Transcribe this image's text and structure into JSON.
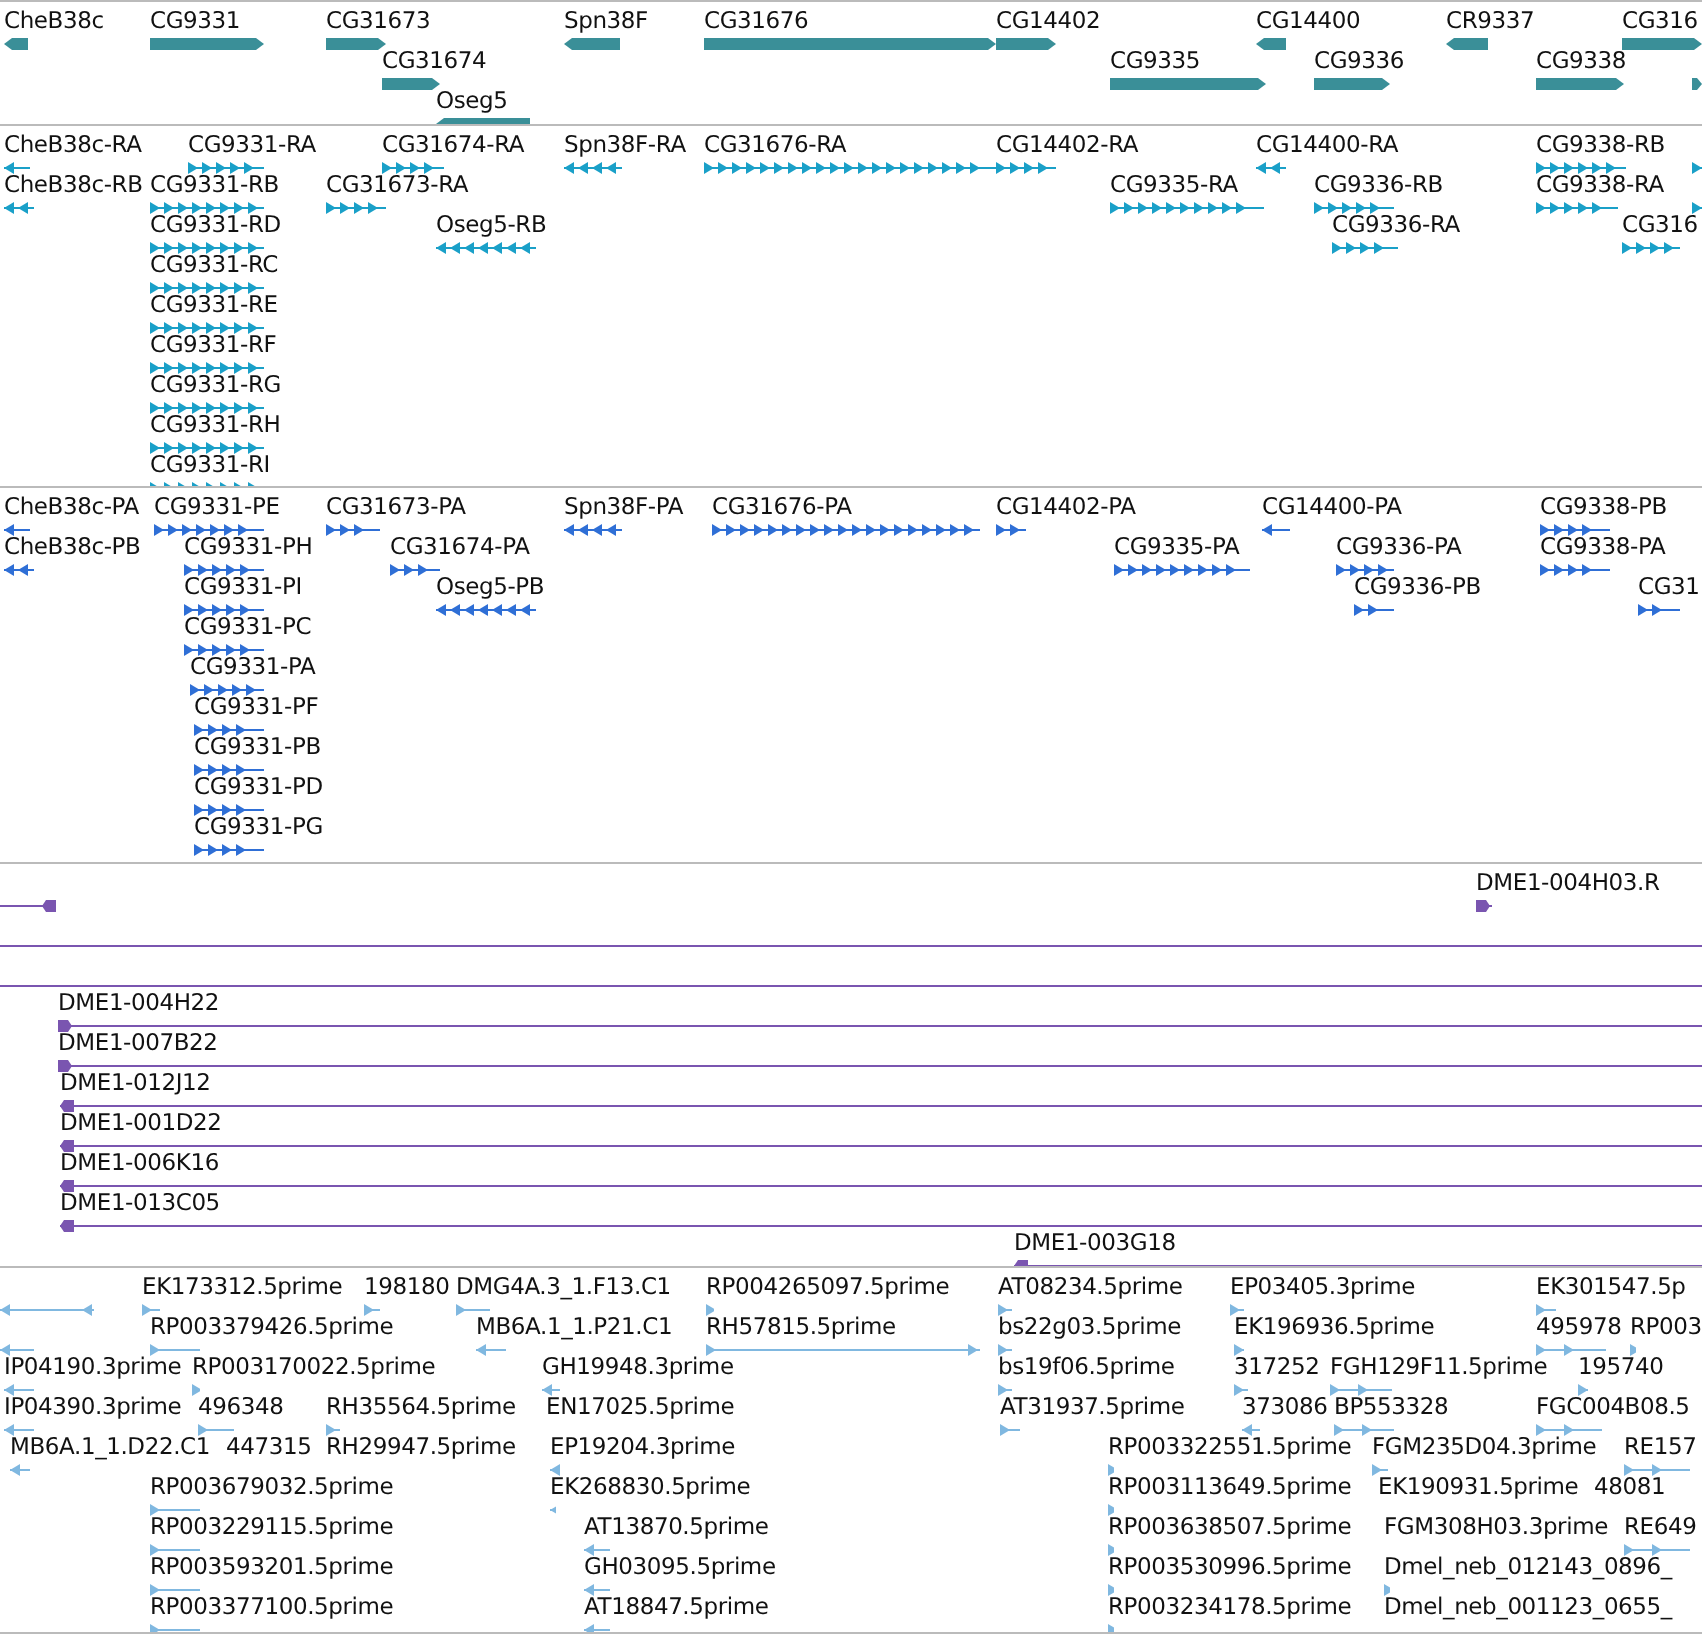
{
  "tracks": [
    {
      "kind": "gene",
      "color": "#3a8f98",
      "features": [
        {
          "label": "CheB38c",
          "reverse": true
        },
        {
          "label": "CG9331",
          "reverse": false
        },
        {
          "label": "CG31673",
          "reverse": false
        },
        {
          "label": "Spn38F",
          "reverse": true
        },
        {
          "label": "CG31676",
          "reverse": false
        },
        {
          "label": "CG14402",
          "reverse": false
        },
        {
          "label": "CG14400",
          "reverse": true
        },
        {
          "label": "CR9337",
          "reverse": true
        },
        {
          "label": "CG316",
          "reverse": false
        },
        {
          "label": "CG31674",
          "reverse": false
        },
        {
          "label": "CG9335",
          "reverse": false
        },
        {
          "label": "CG9336",
          "reverse": false
        },
        {
          "label": "CG9338",
          "reverse": false
        },
        {
          "reverse": false
        },
        {
          "label": "Oseg5",
          "reverse": true
        }
      ]
    },
    {
      "kind": "transcript",
      "color": "#1aa0c8",
      "features": [
        {
          "label": "CheB38c-RA",
          "reverse": true
        },
        {
          "label": "CG9331-RA",
          "reverse": false
        },
        {
          "label": "CG31674-RA",
          "reverse": false
        },
        {
          "label": "Spn38F-RA",
          "reverse": true
        },
        {
          "label": "CG31676-RA",
          "reverse": false
        },
        {
          "label": "CG14402-RA",
          "reverse": false
        },
        {
          "label": "CG14400-RA",
          "reverse": true
        },
        {
          "label": "CG9338-RB",
          "reverse": false
        },
        {
          "reverse": false
        },
        {
          "label": "CheB38c-RB",
          "reverse": true
        },
        {
          "label": "CG9331-RB",
          "reverse": false
        },
        {
          "label": "CG31673-RA",
          "reverse": false
        },
        {
          "label": "CG9335-RA",
          "reverse": false
        },
        {
          "label": "CG9336-RB",
          "reverse": false
        },
        {
          "label": "CG9338-RA",
          "reverse": false
        },
        {
          "reverse": false
        },
        {
          "label": "CG9331-RD",
          "reverse": false
        },
        {
          "label": "Oseg5-RB",
          "reverse": true
        },
        {
          "label": "CG9336-RA",
          "reverse": false
        },
        {
          "label": "CG316",
          "reverse": false
        },
        {
          "label": "CG9331-RC",
          "reverse": false
        },
        {
          "label": "CG9331-RE",
          "reverse": false
        },
        {
          "label": "CG9331-RF",
          "reverse": false
        },
        {
          "label": "CG9331-RG",
          "reverse": false
        },
        {
          "label": "CG9331-RH",
          "reverse": false
        },
        {
          "label": "CG9331-RI",
          "reverse": false
        }
      ]
    },
    {
      "kind": "transcript",
      "color": "#2f6fd6",
      "features": [
        {
          "label": "CheB38c-PA",
          "reverse": true
        },
        {
          "label": "CG9331-PE",
          "reverse": false
        },
        {
          "label": "CG31673-PA",
          "reverse": false
        },
        {
          "label": "Spn38F-PA",
          "reverse": true
        },
        {
          "label": "CG31676-PA",
          "reverse": false
        },
        {
          "label": "CG14402-PA",
          "reverse": false
        },
        {
          "label": "CG14400-PA",
          "reverse": true
        },
        {
          "label": "CG9338-PB",
          "reverse": false
        },
        {
          "label": "CheB38c-PB",
          "reverse": true
        },
        {
          "label": "CG9331-PH",
          "reverse": false
        },
        {
          "label": "CG31674-PA",
          "reverse": false
        },
        {
          "label": "CG9335-PA",
          "reverse": false
        },
        {
          "label": "CG9336-PA",
          "reverse": false
        },
        {
          "label": "CG9338-PA",
          "reverse": false
        },
        {
          "label": "CG9331-PI",
          "reverse": false
        },
        {
          "label": "Oseg5-PB",
          "reverse": true
        },
        {
          "label": "CG9336-PB",
          "reverse": false
        },
        {
          "label": "CG31",
          "reverse": false
        },
        {
          "label": "CG9331-PC",
          "reverse": false
        },
        {
          "label": "CG9331-PA",
          "reverse": false
        },
        {
          "label": "CG9331-PF",
          "reverse": false
        },
        {
          "label": "CG9331-PB",
          "reverse": false
        },
        {
          "label": "CG9331-PD",
          "reverse": false
        },
        {
          "label": "CG9331-PG",
          "reverse": false
        }
      ]
    },
    {
      "kind": "clone",
      "color": "#7a55b0",
      "features": [
        {
          "reverse": true
        },
        {
          "label": "DME1-004H03.R",
          "reverse": false
        },
        {
          "kind": "span"
        },
        {
          "kind": "span"
        },
        {
          "label": "DME1-004H22",
          "reverse": false
        },
        {
          "label": "DME1-007B22",
          "reverse": false
        },
        {
          "label": "DME1-012J12",
          "reverse": true
        },
        {
          "label": "DME1-001D22",
          "reverse": true
        },
        {
          "label": "DME1-006K16",
          "reverse": true
        },
        {
          "label": "DME1-013C05",
          "reverse": true
        },
        {
          "label": "DME1-003G18",
          "reverse": true
        }
      ]
    },
    {
      "kind": "est",
      "color": "#80b8e0",
      "features": [
        {
          "reverse": true
        },
        {
          "label": "EK173312.5prime",
          "reverse": false
        },
        {
          "label": "198180",
          "reverse": false
        },
        {
          "label": "DMG4A.3_1.F13.C1",
          "reverse": false
        },
        {
          "label": "RP004265097.5prime",
          "reverse": false
        },
        {
          "label": "AT08234.5prime",
          "reverse": false
        },
        {
          "label": "EP03405.3prime",
          "reverse": false
        },
        {
          "label": "EK301547.5p",
          "reverse": false
        },
        {
          "reverse": true
        },
        {
          "label": "RP003379426.5prime",
          "reverse": false
        },
        {
          "label": "MB6A.1_1.P21.C1",
          "reverse": true
        },
        {
          "label": "RH57815.5prime",
          "reverse": false
        },
        {
          "label": "bs22g03.5prime",
          "reverse": false
        },
        {
          "label": "EK196936.5prime",
          "reverse": false
        },
        {
          "label": "495978",
          "reverse": false
        },
        {
          "label": "RP003",
          "reverse": false
        },
        {
          "label": "IP04190.3prime",
          "reverse": true
        },
        {
          "label": "RP003170022.5prime",
          "reverse": false
        },
        {
          "label": "GH19948.3prime",
          "reverse": true
        },
        {
          "label": "bs19f06.5prime",
          "reverse": false
        },
        {
          "label": "317252",
          "reverse": false
        },
        {
          "label": "FGH129F11.5prime",
          "reverse": false
        },
        {
          "label": "195740",
          "reverse": false
        },
        {
          "label": "IP04390.3prime",
          "reverse": true
        },
        {
          "label": "496348",
          "reverse": false
        },
        {
          "label": "RH35564.5prime",
          "reverse": false
        },
        {
          "label": "EN17025.5prime"
        },
        {
          "label": "AT31937.5prime",
          "reverse": false
        },
        {
          "label": "373086",
          "reverse": true
        },
        {
          "label": "BP553328",
          "reverse": false
        },
        {
          "label": "FGC004B08.5",
          "reverse": false
        },
        {
          "label": "MB6A.1_1.D22.C1",
          "reverse": true
        },
        {
          "label": "447315"
        },
        {
          "label": "RH29947.5prime"
        },
        {
          "label": "EP19204.3prime",
          "reverse": true
        },
        {
          "label": "RP003322551.5prime",
          "reverse": false
        },
        {
          "label": "FGM235D04.3prime",
          "reverse": false
        },
        {
          "label": "RE157",
          "reverse": false
        },
        {
          "label": "RP003679032.5prime",
          "reverse": false
        },
        {
          "label": "EK268830.5prime",
          "reverse": true
        },
        {
          "label": "RP003113649.5prime",
          "reverse": false
        },
        {
          "label": "EK190931.5prime"
        },
        {
          "label": "48081"
        },
        {
          "label": "RP003229115.5prime",
          "reverse": false
        },
        {
          "label": "AT13870.5prime",
          "reverse": true
        },
        {
          "label": "RP003638507.5prime",
          "reverse": false
        },
        {
          "label": "FGM308H03.3prime"
        },
        {
          "label": "RE649",
          "reverse": false
        },
        {
          "label": "RP003593201.5prime",
          "reverse": false
        },
        {
          "label": "GH03095.5prime",
          "reverse": true
        },
        {
          "label": "RP003530996.5prime",
          "reverse": false
        },
        {
          "label": "Dmel_neb_012143_0896_",
          "reverse": false
        },
        {
          "label": "RP003377100.5prime",
          "reverse": false
        },
        {
          "label": "AT18847.5prime",
          "reverse": true
        },
        {
          "label": "RP003234178.5prime",
          "reverse": false
        },
        {
          "label": "Dmel_neb_001123_0655_"
        }
      ]
    }
  ]
}
